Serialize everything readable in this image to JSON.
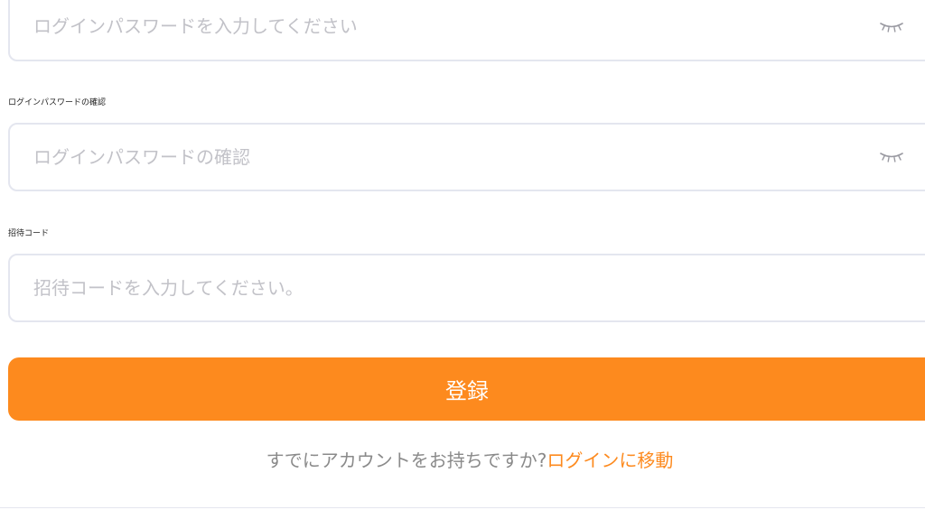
{
  "password_field": {
    "placeholder": "ログインパスワードを入力してください",
    "visibility_icon": "closed-eye-icon"
  },
  "confirm_password_field": {
    "label": "ログインパスワードの確認",
    "placeholder": "ログインパスワードの確認",
    "visibility_icon": "closed-eye-icon"
  },
  "invite_code_field": {
    "label": "招待コード",
    "placeholder": "招待コードを入力してください。"
  },
  "register_button": {
    "label": "登録"
  },
  "footer": {
    "prompt": "すでにアカウントをお持ちですか?",
    "login_link": "ログインに移動"
  },
  "colors": {
    "accent": "#fd8a1e",
    "field_border": "#e4e6ef",
    "placeholder": "#c2c2c8",
    "footer_text": "#8a8a8a"
  }
}
